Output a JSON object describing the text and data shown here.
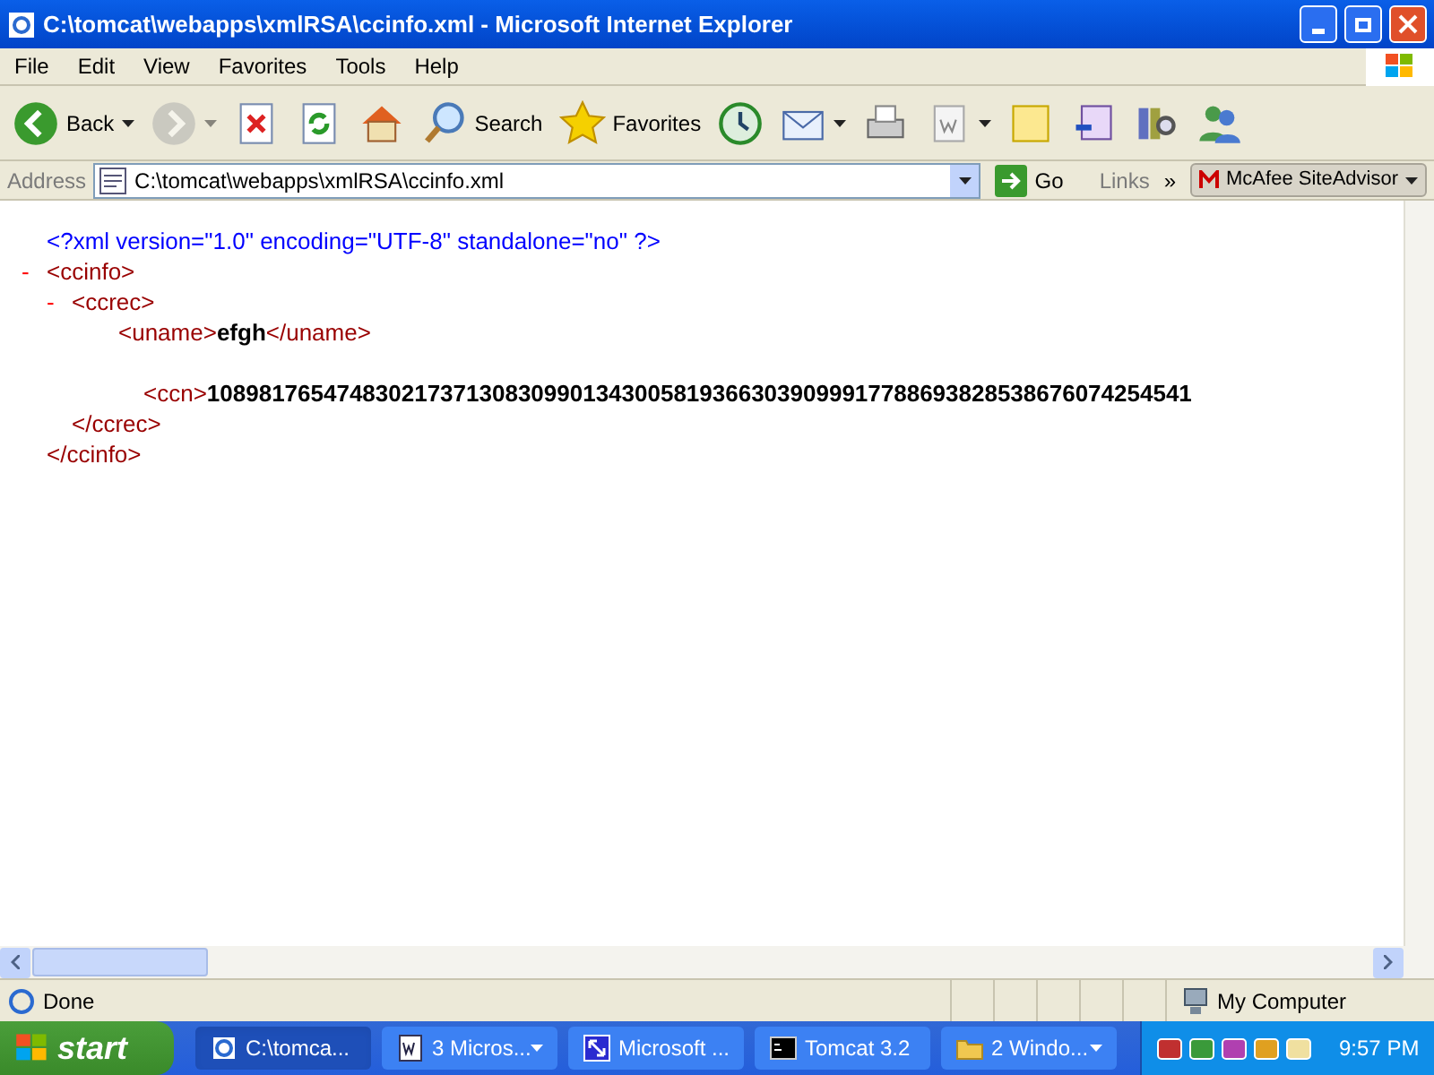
{
  "window": {
    "title": "C:\\tomcat\\webapps\\xmlRSA\\ccinfo.xml - Microsoft Internet Explorer"
  },
  "menu": [
    "File",
    "Edit",
    "View",
    "Favorites",
    "Tools",
    "Help"
  ],
  "toolbar": [
    {
      "kind": "back",
      "label": "Back",
      "dropdown": true,
      "disabled": false
    },
    {
      "kind": "forward",
      "dropdown": true,
      "disabled": true
    },
    {
      "kind": "stop",
      "dropdown": false,
      "disabled": false
    },
    {
      "kind": "refresh",
      "dropdown": false,
      "disabled": false
    },
    {
      "kind": "home",
      "dropdown": false,
      "disabled": false
    },
    {
      "kind": "search",
      "label": "Search",
      "dropdown": false,
      "disabled": false
    },
    {
      "kind": "favorites",
      "label": "Favorites",
      "dropdown": false,
      "disabled": false
    },
    {
      "kind": "history",
      "dropdown": false,
      "disabled": false
    },
    {
      "kind": "mail",
      "dropdown": true,
      "disabled": false
    },
    {
      "kind": "print",
      "dropdown": false,
      "disabled": false
    },
    {
      "kind": "edit",
      "dropdown": true,
      "disabled": false
    },
    {
      "kind": "note",
      "dropdown": false,
      "disabled": false
    },
    {
      "kind": "messenger",
      "dropdown": false,
      "disabled": false
    },
    {
      "kind": "research",
      "dropdown": false,
      "disabled": false
    },
    {
      "kind": "people",
      "dropdown": false,
      "disabled": false
    }
  ],
  "address_bar": {
    "label": "Address",
    "value": "C:\\tomcat\\webapps\\xmlRSA\\ccinfo.xml",
    "go": "Go",
    "links": "Links",
    "chevron": "»",
    "addon": "McAfee SiteAdvisor"
  },
  "document": {
    "declaration": "<?xml version=\"1.0\" encoding=\"UTF-8\" standalone=\"no\" ?>",
    "tree": {
      "toggle": "-",
      "open": "<ccinfo>",
      "close": "</ccinfo>",
      "children": [
        {
          "toggle": "-",
          "open": "<ccrec>",
          "close": "</ccrec>",
          "children": [
            {
              "kind": "leaf",
              "open": "<uname>",
              "value": "efgh",
              "close": "</uname>"
            },
            {
              "kind": "spaced",
              "open": "<ccn>",
              "value": "1089817654748302173713083099013430058193663039099917788693828538676074254541"
            }
          ]
        }
      ]
    }
  },
  "status_bar": {
    "text": "Done",
    "zone": "My Computer"
  },
  "taskbar": {
    "start": "start",
    "clock": "9:57 PM",
    "buttons": [
      {
        "kind": "ie",
        "label": "C:\\tomca...",
        "selected": true,
        "menu": false
      },
      {
        "kind": "word",
        "label": "3 Micros...",
        "selected": false,
        "menu": true
      },
      {
        "kind": "app",
        "label": "Microsoft ...",
        "selected": false,
        "menu": false
      },
      {
        "kind": "console",
        "label": "Tomcat 3.2",
        "selected": false,
        "menu": false
      },
      {
        "kind": "folder",
        "label": "2 Windo...",
        "selected": false,
        "menu": true
      }
    ]
  }
}
